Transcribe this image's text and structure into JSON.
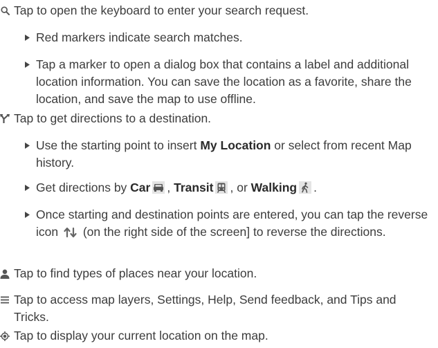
{
  "items": [
    {
      "icon": "search-icon",
      "text": "Tap to open the keyboard to enter your search request.",
      "sub": [
        "Red markers indicate search matches.",
        "Tap a marker to open a dialog box that contains a label and additional location information. You can save the location as a favorite, share the location, and save the map to use offline."
      ]
    },
    {
      "icon": "directions-icon",
      "text": "Tap to get directions to a destination.",
      "sub1": {
        "before": "Use the starting point to insert ",
        "bold": "My Location",
        "after": " or select from recent Map history."
      },
      "sub2": {
        "lead": "Get directions by ",
        "car": "Car",
        "sep1": ", ",
        "transit": "Transit",
        "sep2": ", or ",
        "walking": "Walking",
        "end": "."
      },
      "sub3": {
        "before": "Once starting and destination points are entered, you can tap the reverse icon ",
        "after": " (on the right side of the screen] to reverse the directions."
      }
    },
    {
      "icon": "person-icon",
      "text": "Tap to find types of places near your location."
    },
    {
      "icon": "menu-icon",
      "text": "Tap to access map layers, Settings, Help, Send feedback, and Tips and Tricks."
    },
    {
      "icon": "my-location-icon",
      "text": "Tap to display your current location on the map."
    }
  ],
  "colors": {
    "text": "#3c3c3c",
    "icon": "#555555"
  }
}
